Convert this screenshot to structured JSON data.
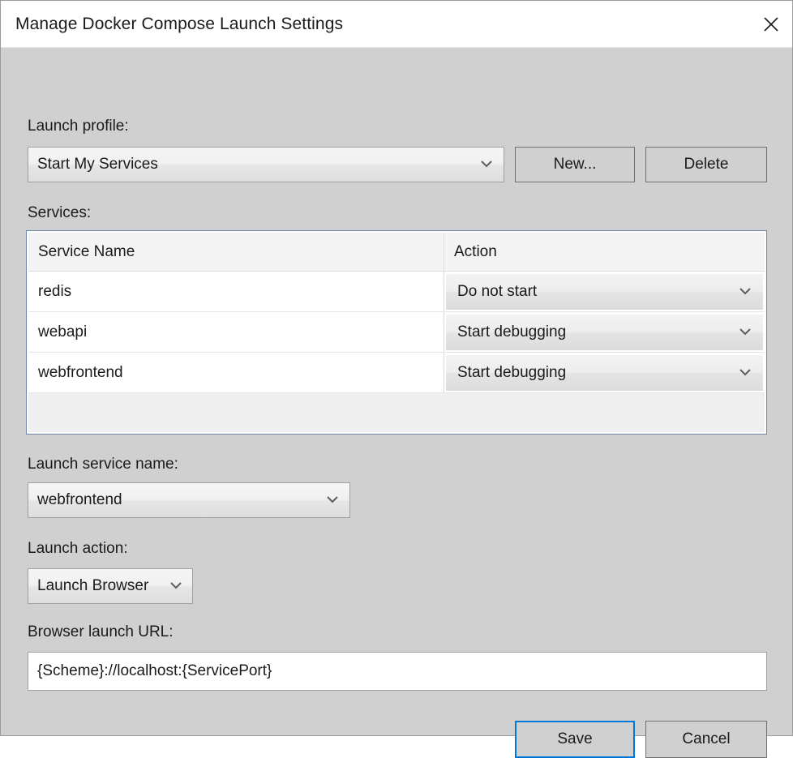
{
  "window": {
    "title": "Manage Docker Compose Launch Settings",
    "close_icon": "close-icon"
  },
  "launch_profile": {
    "label": "Launch profile:",
    "value": "Start My Services",
    "new_button": "New...",
    "delete_button": "Delete"
  },
  "services": {
    "label": "Services:",
    "columns": [
      "Service Name",
      "Action"
    ],
    "rows": [
      {
        "name": "redis",
        "action": "Do not start"
      },
      {
        "name": "webapi",
        "action": "Start debugging"
      },
      {
        "name": "webfrontend",
        "action": "Start debugging"
      }
    ]
  },
  "launch_service_name": {
    "label": "Launch service name:",
    "value": "webfrontend"
  },
  "launch_action": {
    "label": "Launch action:",
    "value": "Launch Browser"
  },
  "browser_launch_url": {
    "label": "Browser launch URL:",
    "value": "{Scheme}://localhost:{ServicePort}"
  },
  "footer": {
    "save_label": "Save",
    "cancel_label": "Cancel"
  },
  "colors": {
    "dialog_background": "#d0d0d0",
    "titlebar_background": "#ffffff",
    "text": "#1a1a1a",
    "accent": "#0078d7",
    "grid_border": "#6d88ab",
    "grid_header": "#f4f4f4",
    "grid_filler": "#efefef"
  }
}
